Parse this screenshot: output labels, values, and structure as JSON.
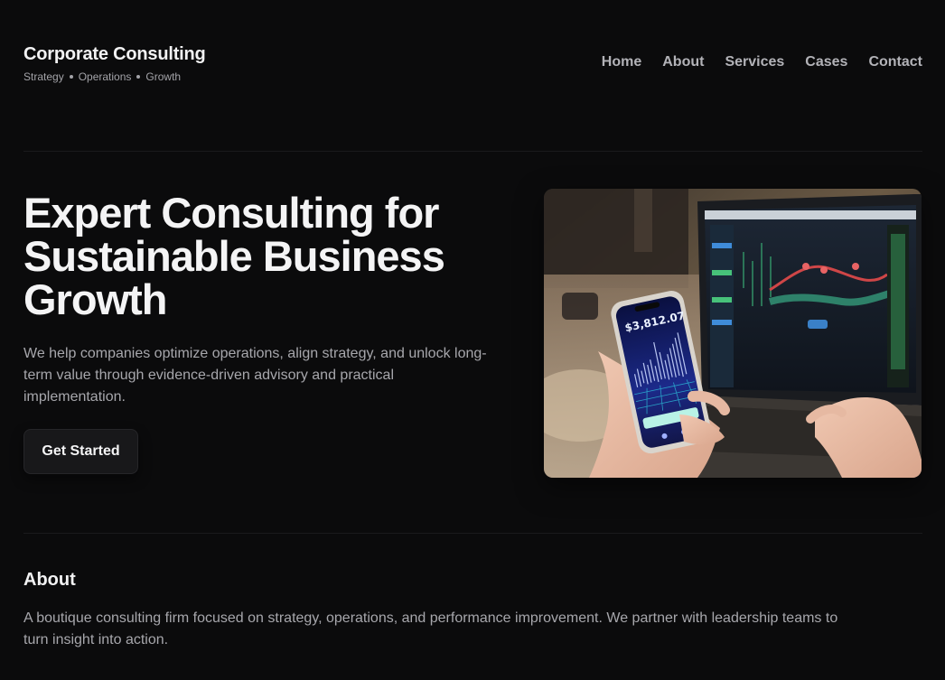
{
  "brand": {
    "title": "Corporate Consulting",
    "tagline": [
      "Strategy",
      "Operations",
      "Growth"
    ]
  },
  "nav": {
    "items": [
      "Home",
      "About",
      "Services",
      "Cases",
      "Contact"
    ]
  },
  "hero": {
    "title": "Expert Consulting for Sustainable Business Growth",
    "subtitle": "We help companies optimize operations, align strategy, and unlock long-term value through evidence-driven advisory and practical implementation.",
    "cta_label": "Get Started",
    "image_alt": "Hand holding a smartphone showing a trading chart in front of a laptop with financial dashboards",
    "phone_value": "$3,812.07"
  },
  "about": {
    "title": "About",
    "text": "A boutique consulting firm focused on strategy, operations, and performance improvement. We partner with leadership teams to turn insight into action."
  },
  "colors": {
    "background": "#0b0b0c",
    "heading": "#f4f4f5",
    "body_text": "#a7a7ac",
    "nav_text": "#b3b3b8",
    "button_bg": "#18181a"
  }
}
